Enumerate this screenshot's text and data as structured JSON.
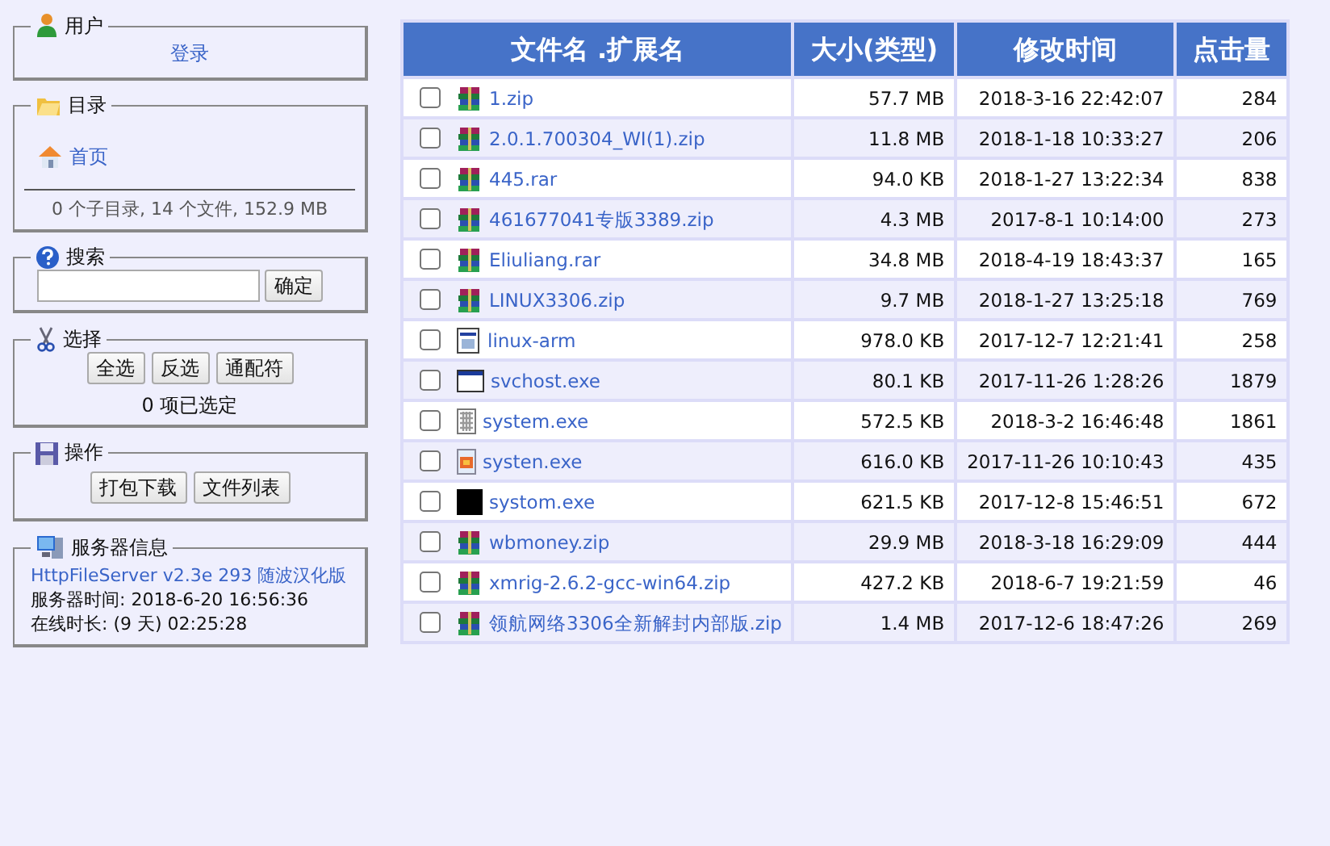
{
  "sidebar": {
    "user": {
      "title": "用户",
      "login_link": "登录"
    },
    "folder": {
      "title": "目录",
      "home_link": "首页",
      "summary": "0 个子目录, 14 个文件, 152.9 MB"
    },
    "search": {
      "title": "搜索",
      "button": "确定"
    },
    "select": {
      "title": "选择",
      "buttons": [
        "全选",
        "反选",
        "通配符"
      ],
      "status": "0 项已选定"
    },
    "actions": {
      "title": "操作",
      "buttons": [
        "打包下载",
        "文件列表"
      ]
    },
    "server": {
      "title": "服务器信息",
      "link": "HttpFileServer v2.3e 293 随波汉化版",
      "lines": [
        "服务器时间: 2018-6-20 16:56:36",
        "在线时长: (9 天) 02:25:28"
      ]
    }
  },
  "table": {
    "columns": [
      "文件名 .扩展名",
      "大小(类型)",
      "修改时间",
      "点击量"
    ],
    "rows": [
      {
        "checked": false,
        "kind": "archive",
        "name": "1.zip",
        "size": "57.7 MB",
        "modified": "2018-3-16 22:42:07",
        "hits": "284"
      },
      {
        "checked": false,
        "kind": "archive",
        "name": "2.0.1.700304_WI(1).zip",
        "size": "11.8 MB",
        "modified": "2018-1-18 10:33:27",
        "hits": "206"
      },
      {
        "checked": false,
        "kind": "archive",
        "name": "445.rar",
        "size": "94.0 KB",
        "modified": "2018-1-27 13:22:34",
        "hits": "838"
      },
      {
        "checked": false,
        "kind": "archive",
        "name": "461677041专版3389.zip",
        "size": "4.3 MB",
        "modified": "2017-8-1 10:14:00",
        "hits": "273"
      },
      {
        "checked": false,
        "kind": "archive",
        "name": "Eliuliang.rar",
        "size": "34.8 MB",
        "modified": "2018-4-19 18:43:37",
        "hits": "165"
      },
      {
        "checked": false,
        "kind": "archive",
        "name": "LINUX3306.zip",
        "size": "9.7 MB",
        "modified": "2018-1-27 13:25:18",
        "hits": "769"
      },
      {
        "checked": false,
        "kind": "app",
        "name": "linux-arm",
        "size": "978.0 KB",
        "modified": "2017-12-7 12:21:41",
        "hits": "258"
      },
      {
        "checked": false,
        "kind": "window",
        "name": "svchost.exe",
        "size": "80.1 KB",
        "modified": "2017-11-26 1:28:26",
        "hits": "1879"
      },
      {
        "checked": false,
        "kind": "grid",
        "name": "system.exe",
        "size": "572.5 KB",
        "modified": "2018-3-2 16:46:48",
        "hits": "1861"
      },
      {
        "checked": false,
        "kind": "image",
        "name": "systen.exe",
        "size": "616.0 KB",
        "modified": "2017-11-26 10:10:43",
        "hits": "435"
      },
      {
        "checked": false,
        "kind": "black",
        "name": "systom.exe",
        "size": "621.5 KB",
        "modified": "2017-12-8 15:46:51",
        "hits": "672"
      },
      {
        "checked": false,
        "kind": "archive",
        "name": "wbmoney.zip",
        "size": "29.9 MB",
        "modified": "2018-3-18 16:29:09",
        "hits": "444"
      },
      {
        "checked": false,
        "kind": "archive",
        "name": "xmrig-2.6.2-gcc-win64.zip",
        "size": "427.2 KB",
        "modified": "2018-6-7 19:21:59",
        "hits": "46"
      },
      {
        "checked": false,
        "kind": "archive",
        "name": "领航网络3306全新解封内部版.zip",
        "size": "1.4 MB",
        "modified": "2017-12-6 18:47:26",
        "hits": "269"
      }
    ]
  }
}
